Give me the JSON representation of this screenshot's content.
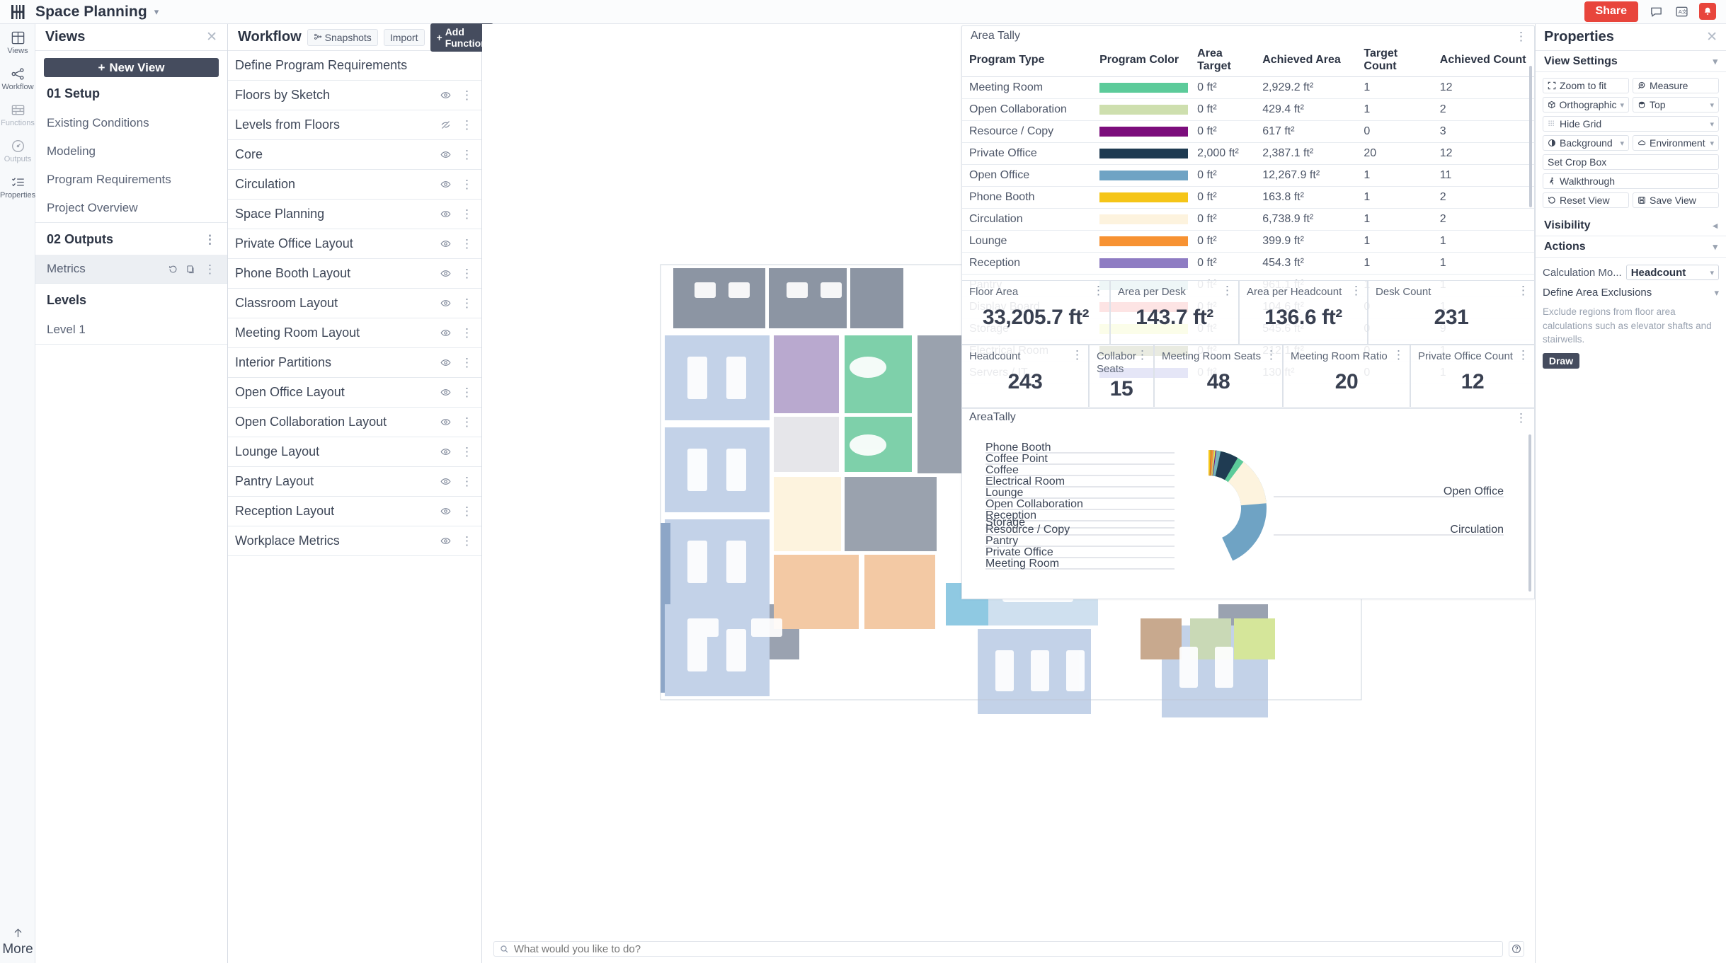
{
  "app": {
    "title": "Space Planning",
    "logo": "hypar-logo-icon",
    "title_caret": "chevron-down-icon"
  },
  "topbar": {
    "share_label": "Share",
    "comment_icon": "comment-icon",
    "translate_icon": "translate-icon",
    "notification_icon": "bell-icon",
    "avatar_initial": ""
  },
  "rail": {
    "items": [
      {
        "label": "Views",
        "icon": "grid-icon",
        "active": true
      },
      {
        "label": "Workflow",
        "icon": "workflow-nodes-icon",
        "active": true
      },
      {
        "label": "Functions",
        "icon": "bricks-icon",
        "active": false
      },
      {
        "label": "Outputs",
        "icon": "gauge-icon",
        "active": false
      },
      {
        "label": "Properties",
        "icon": "checklist-icon",
        "active": true
      }
    ],
    "more_label": "More",
    "more_icon": "arrow-up-icon"
  },
  "views": {
    "title": "Views",
    "close_icon": "close-icon",
    "new_view_label": "New View",
    "new_view_icon": "plus-icon",
    "groups": [
      {
        "label": "01 Setup",
        "items": [
          {
            "label": "Existing Conditions"
          },
          {
            "label": "Modeling"
          },
          {
            "label": "Program Requirements"
          },
          {
            "label": "Project Overview"
          }
        ]
      },
      {
        "label": "02 Outputs",
        "menu_icon": "kebab-icon",
        "items": [
          {
            "label": "Metrics",
            "selected": true,
            "tools": [
              "history-icon",
              "copy-icon",
              "kebab-icon"
            ]
          }
        ]
      },
      {
        "label": "Levels",
        "items": [
          {
            "label": "Level 1"
          }
        ]
      }
    ]
  },
  "workflow": {
    "title": "Workflow",
    "close_icon": "close-icon",
    "snapshots_label": "Snapshots",
    "snapshots_icon": "snapshots-icon",
    "import_label": "Import",
    "add_function_label": "Add Function",
    "add_function_icon": "plus-icon",
    "items": [
      {
        "label": "Define Program Requirements",
        "tools": []
      },
      {
        "label": "Floors by Sketch",
        "tools": [
          "eye-icon",
          "kebab-icon"
        ]
      },
      {
        "label": "Levels from Floors",
        "tools": [
          "eye-off-icon",
          "kebab-icon"
        ]
      },
      {
        "label": "Core",
        "tools": [
          "eye-icon",
          "kebab-icon"
        ]
      },
      {
        "label": "Circulation",
        "tools": [
          "eye-icon",
          "kebab-icon"
        ]
      },
      {
        "label": "Space Planning",
        "tools": [
          "eye-icon",
          "kebab-icon"
        ]
      },
      {
        "label": "Private Office Layout",
        "tools": [
          "eye-icon",
          "kebab-icon"
        ]
      },
      {
        "label": "Phone Booth Layout",
        "tools": [
          "eye-icon",
          "kebab-icon"
        ]
      },
      {
        "label": "Classroom Layout",
        "tools": [
          "eye-icon",
          "kebab-icon"
        ]
      },
      {
        "label": "Meeting Room Layout",
        "tools": [
          "eye-icon",
          "kebab-icon"
        ]
      },
      {
        "label": "Interior Partitions",
        "tools": [
          "eye-icon",
          "kebab-icon"
        ]
      },
      {
        "label": "Open Office Layout",
        "tools": [
          "eye-icon",
          "kebab-icon"
        ]
      },
      {
        "label": "Open Collaboration Layout",
        "tools": [
          "eye-icon",
          "kebab-icon"
        ]
      },
      {
        "label": "Lounge Layout",
        "tools": [
          "eye-icon",
          "kebab-icon"
        ]
      },
      {
        "label": "Pantry Layout",
        "tools": [
          "eye-icon",
          "kebab-icon"
        ]
      },
      {
        "label": "Reception Layout",
        "tools": [
          "eye-icon",
          "kebab-icon"
        ]
      },
      {
        "label": "Workplace Metrics",
        "tools": [
          "eye-icon",
          "kebab-icon"
        ]
      }
    ]
  },
  "area_tally": {
    "title": "Area Tally",
    "menu_icon": "kebab-icon",
    "columns": [
      "Program Type",
      "Program Color",
      "Area Target",
      "Achieved Area",
      "Target Count",
      "Achieved Count"
    ],
    "rows": [
      {
        "type": "Meeting Room",
        "color": "#5ccb9a",
        "target": "0 ft²",
        "achieved": "2,929.2 ft²",
        "target_count": "1",
        "achieved_count": "12"
      },
      {
        "type": "Open Collaboration",
        "color": "#cedfae",
        "target": "0 ft²",
        "achieved": "429.4 ft²",
        "target_count": "1",
        "achieved_count": "2"
      },
      {
        "type": "Resource / Copy",
        "color": "#7c0d7c",
        "target": "0 ft²",
        "achieved": "617 ft²",
        "target_count": "0",
        "achieved_count": "3"
      },
      {
        "type": "Private Office",
        "color": "#1f3b52",
        "target": "2,000 ft²",
        "achieved": "2,387.1 ft²",
        "target_count": "20",
        "achieved_count": "12"
      },
      {
        "type": "Open Office",
        "color": "#6fa3c4",
        "target": "0 ft²",
        "achieved": "12,267.9 ft²",
        "target_count": "1",
        "achieved_count": "11"
      },
      {
        "type": "Phone Booth",
        "color": "#f5c518",
        "target": "0 ft²",
        "achieved": "163.8 ft²",
        "target_count": "1",
        "achieved_count": "2"
      },
      {
        "type": "Circulation",
        "color": "#fdf3de",
        "target": "0 ft²",
        "achieved": "6,738.9 ft²",
        "target_count": "1",
        "achieved_count": "2"
      },
      {
        "type": "Lounge",
        "color": "#f79232",
        "target": "0 ft²",
        "achieved": "399.9 ft²",
        "target_count": "1",
        "achieved_count": "1"
      },
      {
        "type": "Reception",
        "color": "#8e7cc3",
        "target": "0 ft²",
        "achieved": "454.3 ft²",
        "target_count": "1",
        "achieved_count": "1"
      },
      {
        "type": "Pantry",
        "color": "#76b5bb",
        "target": "0 ft²",
        "achieved": "961.1 ft²",
        "target_count": "1",
        "achieved_count": "1"
      },
      {
        "type": "Display Board",
        "color": "#ec2227",
        "target": "0 ft²",
        "achieved": "104.6 ft²",
        "target_count": "0",
        "achieved_count": "1"
      },
      {
        "type": "Storage",
        "color": "#d8ef4a",
        "target": "0 ft²",
        "achieved": "545.6 ft²",
        "target_count": "0",
        "achieved_count": "9"
      },
      {
        "type": "Electrical Room",
        "color": "#4e5b0c",
        "target": "0 ft²",
        "achieved": "212.1 ft²",
        "target_count": "0",
        "achieved_count": "1"
      },
      {
        "type": "Servers / IT",
        "color": "#2c35bd",
        "target": "0 ft²",
        "achieved": "130 ft²",
        "target_count": "0",
        "achieved_count": "1"
      }
    ]
  },
  "metrics": {
    "row1": [
      {
        "label": "Floor Area",
        "value": "33,205.7 ft²",
        "menu_icon": "kebab-icon"
      },
      {
        "label": "Area per Desk",
        "value": "143.7 ft²",
        "menu_icon": "kebab-icon"
      },
      {
        "label": "Area per Headcount",
        "value": "136.6 ft²",
        "menu_icon": "kebab-icon"
      },
      {
        "label": "Desk Count",
        "value": "231",
        "menu_icon": "kebab-icon"
      }
    ],
    "row2": [
      {
        "label": "Headcount",
        "value": "243",
        "menu_icon": "kebab-icon"
      },
      {
        "label": "Collabor Seats",
        "value": "15",
        "menu_icon": "kebab-icon"
      },
      {
        "label": "Meeting Room Seats",
        "value": "48",
        "menu_icon": "kebab-icon"
      },
      {
        "label": "Meeting Room Ratio",
        "value": "20",
        "menu_icon": "kebab-icon"
      },
      {
        "label": "Private Office Count",
        "value": "12",
        "menu_icon": "kebab-icon"
      }
    ]
  },
  "chart_data": {
    "type": "pie",
    "title": "AreaTally",
    "menu_icon": "kebab-icon",
    "legend_position": "leader-lines",
    "labels": [
      "Open Office",
      "Circulation",
      "Meeting Room",
      "Private Office",
      "Pantry",
      "Resource / Copy",
      "Storage",
      "Reception",
      "Open Collaboration",
      "Lounge",
      "Electrical Room",
      "Coffee",
      "Coffee Point",
      "Phone Booth"
    ],
    "values": [
      12267.9,
      6738.9,
      2929.2,
      2387.1,
      961.1,
      617,
      545.6,
      454.3,
      429.4,
      399.9,
      212.1,
      180,
      150,
      163.8
    ],
    "colors": [
      "#6fa3c4",
      "#fdf3de",
      "#5ccb9a",
      "#1f3b52",
      "#76b5bb",
      "#7c0d7c",
      "#d8ef4a",
      "#8e7cc3",
      "#cedfae",
      "#f79232",
      "#4e5b0c",
      "#ef6fa4",
      "#2c35bd",
      "#f5c518"
    ],
    "left_labels": [
      "Phone Booth",
      "Coffee Point",
      "Coffee",
      "Electrical Room",
      "Lounge",
      "Open Collaboration",
      "Reception",
      "Storage",
      "Resource / Copy",
      "Pantry",
      "Private Office",
      "Meeting Room"
    ],
    "right_labels": [
      "Open Office",
      "Circulation"
    ],
    "unit": "ft²"
  },
  "prompt": {
    "placeholder": "What would you like to do?",
    "search_icon": "search-icon",
    "help_icon": "help-circle-icon"
  },
  "properties": {
    "title": "Properties",
    "close_icon": "close-icon",
    "view_settings": {
      "title": "View Settings",
      "chevron": "chevron-down-icon",
      "buttons": [
        {
          "label": "Zoom to fit",
          "icon": "zoom-fit-icon",
          "dropdown": false
        },
        {
          "label": "Measure",
          "icon": "measure-icon",
          "dropdown": false
        },
        {
          "label": "Orthographic",
          "icon": "cube-icon",
          "dropdown": true
        },
        {
          "label": "Top",
          "icon": "view-top-icon",
          "dropdown": true
        },
        {
          "label": "Hide Grid",
          "icon": "grid-dots-icon",
          "dropdown": true
        },
        {
          "label": "Background",
          "icon": "contrast-icon",
          "dropdown": true
        },
        {
          "label": "Environment",
          "icon": "cloud-icon",
          "dropdown": true
        },
        {
          "label": "Set Crop Box",
          "icon": "",
          "dropdown": false
        },
        {
          "label": "Walkthrough",
          "icon": "walk-icon",
          "dropdown": false
        },
        {
          "label": "Reset View",
          "icon": "undo-icon",
          "dropdown": false
        },
        {
          "label": "Save View",
          "icon": "save-icon",
          "dropdown": false
        }
      ]
    },
    "visibility": {
      "title": "Visibility",
      "chevron": "chevron-left-icon"
    },
    "actions": {
      "title": "Actions",
      "chevron": "chevron-down-icon",
      "calc_mode_label": "Calculation Mo...",
      "calc_mode_value": "Headcount",
      "exclusions_label": "Define Area Exclusions",
      "exclusions_hint": "Exclude regions from floor area calculations such as elevator shafts and stairwells.",
      "draw_label": "Draw"
    }
  },
  "colors": {
    "accent_red": "#e8453c",
    "dark_button": "#454c5e",
    "panel_border": "#d7dce4"
  }
}
